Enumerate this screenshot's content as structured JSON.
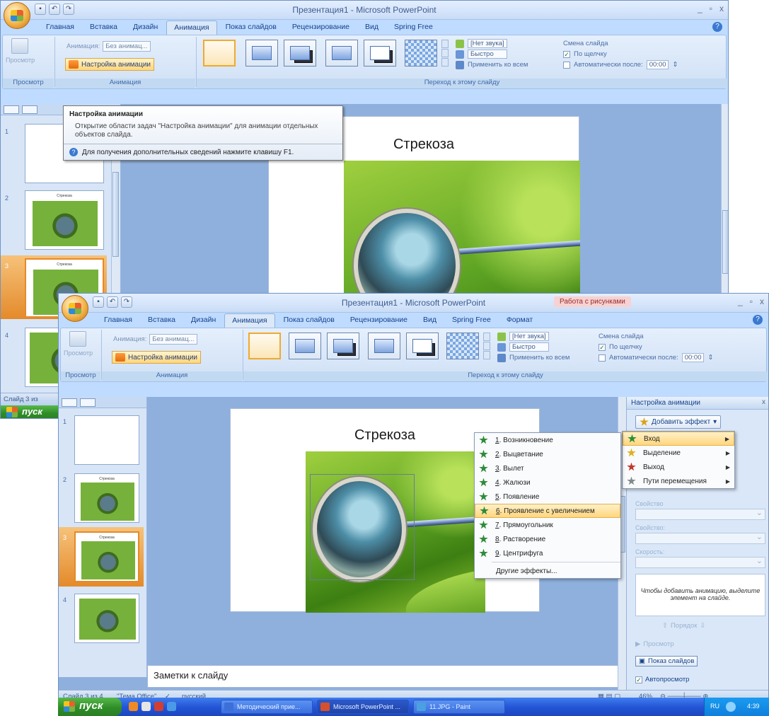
{
  "back_window": {
    "title": "Презентация1 - Microsoft PowerPoint",
    "qat_icons": [
      "save-icon",
      "undo-icon",
      "redo-icon"
    ],
    "controls": {
      "minimize": "_",
      "maximize": "▫",
      "close": "x"
    },
    "tabs": [
      "Главная",
      "Вставка",
      "Дизайн",
      "Анимация",
      "Показ слайдов",
      "Рецензирование",
      "Вид",
      "Spring Free"
    ],
    "active_tab": "Анимация",
    "ribbon": {
      "preview_label": "Просмотр",
      "animation_label": "Анимация:",
      "animation_value": "Без анимац...",
      "custom_animation": "Настройка анимации",
      "group_preview": "Просмотр",
      "group_animation": "Анимация",
      "group_transition": "Переход к этому слайду",
      "sound_value": "[Нет звука]",
      "speed_value": "Быстро",
      "apply_all": "Применить ко всем",
      "advance_title": "Смена слайда",
      "on_click": "По щелчку",
      "auto_after": "Автоматически после:",
      "time": "00:00"
    },
    "tooltip": {
      "title": "Настройка анимации",
      "body": "Открытие области задач \"Настройка анимации\" для анимации отдельных объектов слайда.",
      "footer": "Для получения дополнительных сведений нажмите клавишу F1."
    },
    "thumbnails": [
      {
        "num": "1",
        "title": ""
      },
      {
        "num": "2",
        "title": "Стрекоза"
      },
      {
        "num": "3",
        "title": "Стрекоза"
      },
      {
        "num": "4",
        "title": ""
      }
    ],
    "status_fragment": "Слайд 3 из",
    "start_fragment": "пуск",
    "slide_title": "Стрекоза"
  },
  "front_window": {
    "title": "Презентация1 - Microsoft PowerPoint",
    "context_tab_group": "Работа с рисунками",
    "controls": {
      "minimize": "_",
      "maximize": "▫",
      "close": "x"
    },
    "tabs": [
      "Главная",
      "Вставка",
      "Дизайн",
      "Анимация",
      "Показ слайдов",
      "Рецензирование",
      "Вид",
      "Spring Free",
      "Формат"
    ],
    "active_tab": "Анимация",
    "ribbon": {
      "preview_label": "Просмотр",
      "animation_label": "Анимация:",
      "animation_value": "Без анимац...",
      "custom_animation": "Настройка анимации",
      "group_preview": "Просмотр",
      "group_animation": "Анимация",
      "group_transition": "Переход к этому слайду",
      "sound_value": "[Нет звука]",
      "speed_value": "Быстро",
      "apply_all": "Применить ко всем",
      "advance_title": "Смена слайда",
      "on_click": "По щелчку",
      "auto_after": "Автоматически после:",
      "time": "00:00"
    },
    "thumbnails": [
      {
        "num": "1",
        "title": ""
      },
      {
        "num": "2",
        "title": "Стрекоза"
      },
      {
        "num": "3",
        "title": "Стрекоза"
      },
      {
        "num": "4",
        "title": ""
      }
    ],
    "slide_title": "Стрекоза",
    "notes_placeholder": "Заметки к слайду",
    "effects_menu": [
      {
        "key": "1",
        "label": "Возникновение",
        "color": "#2e8b3a"
      },
      {
        "key": "2",
        "label": "Выцветание",
        "color": "#2e8b3a"
      },
      {
        "key": "3",
        "label": "Вылет",
        "color": "#2e8b3a"
      },
      {
        "key": "4",
        "label": "Жалюзи",
        "color": "#2e8b3a"
      },
      {
        "key": "5",
        "label": "Появление",
        "color": "#2e8b3a"
      },
      {
        "key": "6",
        "label": "Проявление с увеличением",
        "color": "#2e8b3a"
      },
      {
        "key": "7",
        "label": "Прямоугольник",
        "color": "#2e8b3a"
      },
      {
        "key": "8",
        "label": "Растворение",
        "color": "#2e8b3a"
      },
      {
        "key": "9",
        "label": "Центрифуга",
        "color": "#2e8b3a"
      }
    ],
    "effects_more": "Другие эффекты...",
    "highlighted_effect_index": 5,
    "task_pane": {
      "title": "Настройка анимации",
      "close": "x",
      "add_effect": "Добавить эффект",
      "submenu": [
        {
          "label": "Вход",
          "color": "#2e8b3a"
        },
        {
          "label": "Выделение",
          "color": "#e0b020"
        },
        {
          "label": "Выход",
          "color": "#c0392b"
        },
        {
          "label": "Пути перемещения",
          "color": "#7f8c8d"
        }
      ],
      "field_start": "Свойство",
      "field_property": "Свойство:",
      "field_speed": "Скорость:",
      "hint": "Чтобы добавить анимацию, выделите элемент на слайде.",
      "reorder": "Порядок",
      "play": "Просмотр",
      "slideshow": "Показ слайдов",
      "autopreview": "Автопросмотр"
    },
    "status": {
      "slide": "Слайд 3 из 4",
      "theme": "\"Тема Office\"",
      "lang": "русский",
      "zoom": "46%"
    }
  },
  "taskbar": {
    "start": "пуск",
    "tasks": [
      {
        "label": "Методический прие...",
        "color": "#3c6fd8"
      },
      {
        "label": "Microsoft PowerPoint ...",
        "color": "#d6502d"
      },
      {
        "label": "11.JPG - Paint",
        "color": "#4aa0e0"
      }
    ],
    "lang": "RU",
    "clock": "4:39"
  }
}
